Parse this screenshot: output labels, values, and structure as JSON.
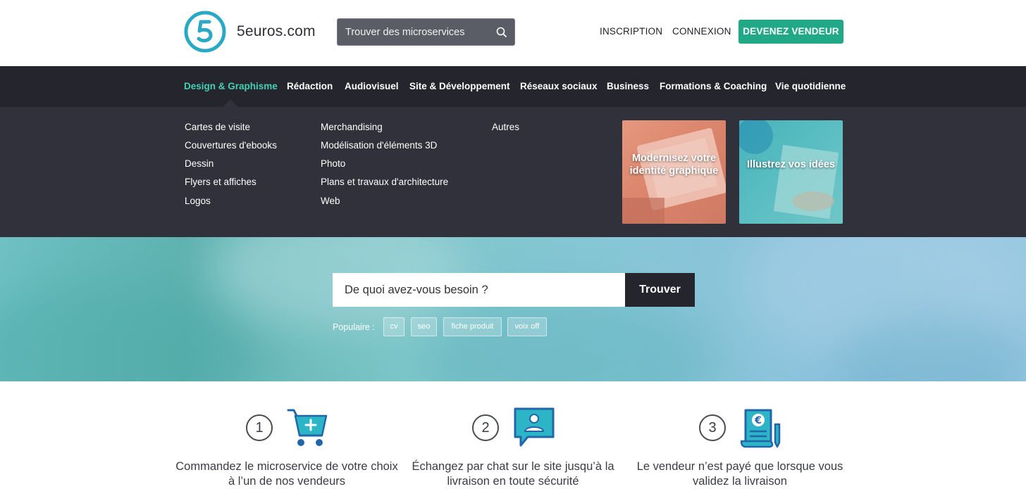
{
  "header": {
    "brand": "5euros.com",
    "search_placeholder": "Trouver des microservices",
    "nav": [
      "INSCRIPTION",
      "CONNEXION"
    ],
    "cta": "DEVENEZ VENDEUR"
  },
  "categories": [
    "Design & Graphisme",
    "Rédaction",
    "Audiovisuel",
    "Site & Développement",
    "Réseaux sociaux",
    "Business",
    "Formations & Coaching",
    "Vie quotidienne"
  ],
  "dropdown": {
    "col1": [
      "Cartes de visite",
      "Couvertures d'ebooks",
      "Dessin",
      "Flyers et affiches",
      "Logos"
    ],
    "col2": [
      "Merchandising",
      "Modélisation d'éléments 3D",
      "Photo",
      "Plans et travaux d'architecture",
      "Web"
    ],
    "col3": [
      "Autres"
    ],
    "promos": [
      "Modernisez votre identité graphique",
      "Illustrez vos idées"
    ]
  },
  "hero": {
    "search_placeholder": "De quoi avez-vous besoin ?",
    "button": "Trouver",
    "popular_label": "Populaire :",
    "tags": [
      "cv",
      "seo",
      "fiche produit",
      "voix off"
    ]
  },
  "steps": [
    {
      "num": "1",
      "icon": "cart-icon",
      "text": "Commandez le microservice de votre choix à l’un de nos vendeurs"
    },
    {
      "num": "2",
      "icon": "chat-icon",
      "text": "Échangez par chat sur le site jusqu’à la livraison en toute sécurité"
    },
    {
      "num": "3",
      "icon": "invoice-icon",
      "text": "Le vendeur n’est payé que lorsque vous validez la livraison"
    }
  ],
  "colors": {
    "accent": "#21a987",
    "active_category": "#45cfb4",
    "dark_nav": "#24252d",
    "dropdown": "#30313a",
    "icon_blue": "#1f9ac9"
  }
}
